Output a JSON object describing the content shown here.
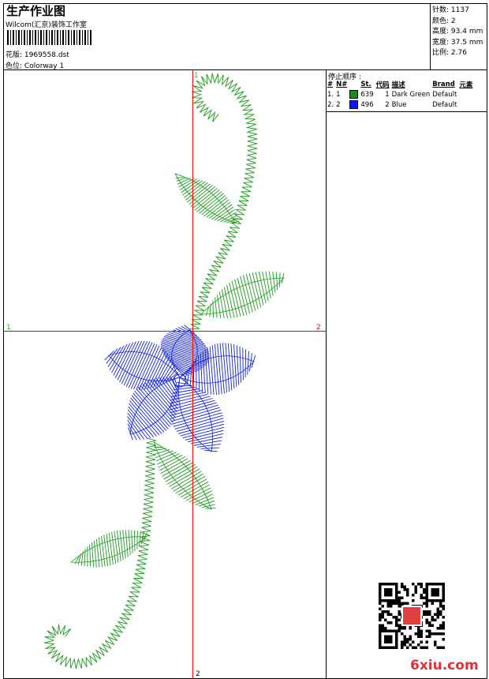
{
  "header": {
    "title": "生产作业图",
    "company": "Wilcom(汇京)装饰工作室",
    "design_label": "花版: 1969558.dst",
    "colorway_label": "色位: Colorway 1"
  },
  "stats": [
    {
      "label": "针数:",
      "value": "1137"
    },
    {
      "label": "颜色:",
      "value": "2"
    },
    {
      "label": "高度:",
      "value": "93.4 mm"
    },
    {
      "label": "宽度:",
      "value": "37.5 mm"
    },
    {
      "label": "比例:",
      "value": "2.76"
    }
  ],
  "stop_sequence": {
    "title": "停止顺序 :",
    "columns": [
      "#",
      "N#",
      "",
      "St.",
      "代码",
      "描述",
      "Brand",
      "元素"
    ],
    "rows": [
      {
        "idx": "1.",
        "n": "1",
        "color": "#1a8c1a",
        "stitches": "639",
        "code": "1",
        "desc": "Dark Green",
        "brand": "Default"
      },
      {
        "idx": "2.",
        "n": "2",
        "color": "#0a1aee",
        "stitches": "496",
        "code": "2",
        "desc": "Blue",
        "brand": "Default"
      }
    ]
  },
  "canvas": {
    "axis_labels": {
      "top": "1",
      "left": "1",
      "right": "2",
      "bottom": "2"
    },
    "thread_colors": {
      "green": "#1a9a1a",
      "blue": "#1020e0"
    },
    "axis_color": "#ff0000"
  },
  "watermark": {
    "text": "6xiu.com",
    "color": "#e0303a"
  }
}
